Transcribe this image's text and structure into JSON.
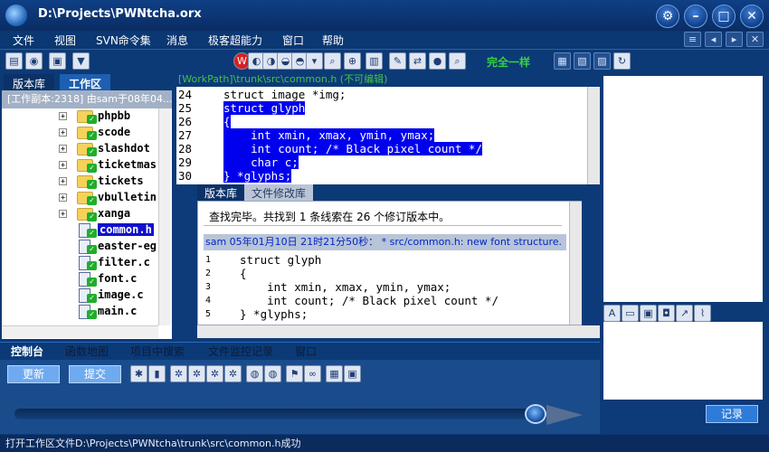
{
  "window": {
    "title": "D:\\Projects\\PWNtcha.orx"
  },
  "menu": [
    "文件",
    "视图",
    "SVN命令集",
    "消息",
    "极客超能力",
    "窗口",
    "帮助"
  ],
  "toolbar": {
    "compare_status": "完全一样",
    "icon_letter_w": "W"
  },
  "left_tabs": [
    "版本库",
    "工作区"
  ],
  "workspace_header": "[工作副本:2318] 由sam于08年04...",
  "tree": [
    {
      "name": "phpbb",
      "type": "folder",
      "expand": "+"
    },
    {
      "name": "scode",
      "type": "folder",
      "expand": "+"
    },
    {
      "name": "slashdot",
      "type": "folder",
      "expand": "+"
    },
    {
      "name": "ticketmas",
      "type": "folder",
      "expand": "+"
    },
    {
      "name": "tickets",
      "type": "folder",
      "expand": "+"
    },
    {
      "name": "vbulletin",
      "type": "folder",
      "expand": "+"
    },
    {
      "name": "xanga",
      "type": "folder",
      "expand": "+"
    },
    {
      "name": "common.h",
      "type": "file",
      "selected": true
    },
    {
      "name": "easter-eg",
      "type": "file"
    },
    {
      "name": "filter.c",
      "type": "file"
    },
    {
      "name": "font.c",
      "type": "file"
    },
    {
      "name": "image.c",
      "type": "file"
    },
    {
      "name": "main.c",
      "type": "file"
    }
  ],
  "editor": {
    "path": "[WorkPath]\\trunk\\src\\common.h (不可编辑)",
    "lines": [
      {
        "n": "24",
        "text": "struct image *img;",
        "hl": false
      },
      {
        "n": "25",
        "text": "struct glyph",
        "hl": true
      },
      {
        "n": "26",
        "text": "{",
        "hl": true
      },
      {
        "n": "27",
        "text": "    int xmin, xmax, ymin, ymax;",
        "hl": true
      },
      {
        "n": "28",
        "text": "    int count; /* Black pixel count */",
        "hl": true
      },
      {
        "n": "29",
        "text": "    char c;",
        "hl": true
      },
      {
        "n": "30",
        "text": "} *glyphs;",
        "hl": true
      }
    ]
  },
  "mid_tabs": [
    "版本库",
    "文件修改库"
  ],
  "search": {
    "result": "查找完毕。共找到 1 条线索在 26 个修订版本中。",
    "revision_header": "sam 05年01月10日 21时21分50秒：  * src/common.h: new font structure.",
    "preview": [
      {
        "n": "1",
        "text": "struct glyph"
      },
      {
        "n": "2",
        "text": "{"
      },
      {
        "n": "3",
        "text": "    int xmin, xmax, ymin, ymax;"
      },
      {
        "n": "4",
        "text": "    int count; /* Black pixel count */"
      },
      {
        "n": "5",
        "text": "} *glyphs;"
      }
    ]
  },
  "bottom_tabs": [
    "控制台",
    "函数地图",
    "项目中搜索",
    "文件监控记录",
    "窗口"
  ],
  "console": {
    "update_label": "更新",
    "commit_label": "提交",
    "progress": 0.96
  },
  "right_panel": {
    "record_label": "记录"
  },
  "status": "打开工作区文件D:\\Projects\\PWNtcha\\trunk\\src\\common.h成功",
  "colors": {
    "accent": "#0d3a78",
    "selection": "#0000ee",
    "status_green": "#1fae2a"
  }
}
